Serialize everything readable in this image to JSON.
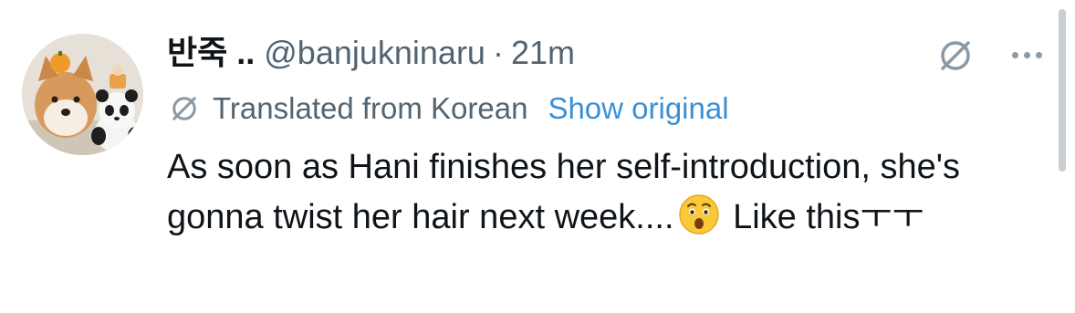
{
  "tweet": {
    "display_name": "반죽 ..",
    "handle": "@banjukninaru",
    "separator": "·",
    "time": "21m",
    "translated_label": "Translated from Korean",
    "show_original_label": "Show original",
    "text": "As soon as Hani finishes her self-introduction, she's gonna twist her hair next week....",
    "text_after_emoji": " Like this",
    "text_tail": "ㅜㅜ",
    "emoji": "astonished-face-icon"
  },
  "icons": {
    "translate": "translate-icon",
    "more": "more-icon",
    "avatar": "avatar-shiba-panda"
  },
  "colors": {
    "text": "#0f1419",
    "secondary": "#536471",
    "link": "#3b8fd6",
    "icon": "#8b98a5"
  }
}
